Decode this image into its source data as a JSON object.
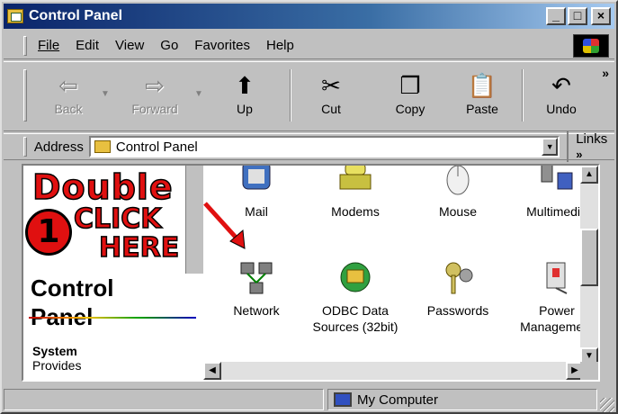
{
  "window": {
    "title": "Control Panel",
    "controls": [
      "_",
      "□",
      "×"
    ]
  },
  "menu": [
    "File",
    "Edit",
    "View",
    "Go",
    "Favorites",
    "Help"
  ],
  "toolbar": {
    "back": "Back",
    "forward": "Forward",
    "up": "Up",
    "cut": "Cut",
    "copy": "Copy",
    "paste": "Paste",
    "undo": "Undo",
    "more": "»"
  },
  "address": {
    "label": "Address",
    "value": "Control Panel",
    "links": "Links",
    "links_more": "»"
  },
  "leftpane": {
    "title_line1": "Control",
    "title_line2": "Panel",
    "system_heading": "System",
    "system_text": "Provides"
  },
  "overlay": {
    "double": "Double",
    "step": "1",
    "click": "CLICK",
    "here": "HERE"
  },
  "icons": {
    "row1": [
      {
        "label": "Mail",
        "icon": "mail-icon"
      },
      {
        "label": "Modems",
        "icon": "modem-icon"
      },
      {
        "label": "Mouse",
        "icon": "mouse-icon"
      },
      {
        "label": "Multimedia",
        "icon": "multimedia-icon"
      }
    ],
    "row2": [
      {
        "label": "Network",
        "icon": "network-icon"
      },
      {
        "label1": "ODBC Data",
        "label2": "Sources (32bit)",
        "icon": "odbc-icon"
      },
      {
        "label": "Passwords",
        "icon": "keys-icon"
      },
      {
        "label1": "Power",
        "label2": "Management",
        "icon": "power-icon"
      }
    ]
  },
  "status": {
    "zone": "My Computer"
  },
  "colors": {
    "titlebar_start": "#0a246a",
    "overlay_red": "#e01010"
  }
}
